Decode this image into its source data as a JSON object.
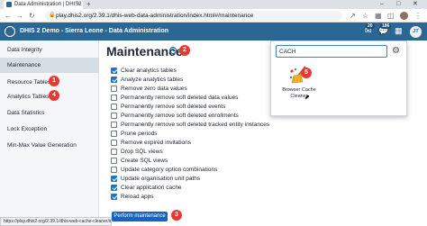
{
  "browser": {
    "tab_title": "Data Administration | DHIS2",
    "tab_close": "×",
    "new_tab": "+",
    "url": "play.dhis2.org/2.39.1/dhis-web-data-administration/index.html#/maintenance",
    "status_url": "https://play.dhis2.org/2.39.1/dhis-web-cache-cleaner/index.action"
  },
  "header": {
    "title": "DHIS 2 Demo - Sierra Leone - Data Administration",
    "messages_count": "20",
    "interpretations_count": "186",
    "user_initials": "JT"
  },
  "sidebar": {
    "items": [
      {
        "label": "Data Integrity"
      },
      {
        "label": "Maintenance"
      },
      {
        "label": "Resource Tables"
      },
      {
        "label": "Analytics Tables"
      },
      {
        "label": "Data Statistics"
      },
      {
        "label": "Lock Exception"
      },
      {
        "label": "Min-Max Value Generation"
      }
    ]
  },
  "main": {
    "title": "Maintenance",
    "help": "?",
    "options": [
      {
        "label": "Clear analytics tables",
        "checked": true
      },
      {
        "label": "Analyze analytics tables",
        "checked": true
      },
      {
        "label": "Remove zero data values",
        "checked": false
      },
      {
        "label": "Permanently remove soft deleted data values",
        "checked": false
      },
      {
        "label": "Permanently remove soft deleted events",
        "checked": false
      },
      {
        "label": "Permanently remove soft deleted enrollments",
        "checked": false
      },
      {
        "label": "Permanently remove soft deleted tracked entity instances",
        "checked": false
      },
      {
        "label": "Prune periods",
        "checked": false
      },
      {
        "label": "Remove expired invitations",
        "checked": false
      },
      {
        "label": "Drop SQL views",
        "checked": false
      },
      {
        "label": "Create SQL views",
        "checked": false
      },
      {
        "label": "Update category option combinations",
        "checked": false
      },
      {
        "label": "Update organisation unit paths",
        "checked": true
      },
      {
        "label": "Clear application cache",
        "checked": true
      },
      {
        "label": "Reload apps",
        "checked": true
      }
    ],
    "perform_button": "Perform maintenance"
  },
  "app_search": {
    "query": "CACH",
    "results": [
      {
        "name": "Browser Cache Cleaner",
        "icon": "broom-icon"
      }
    ]
  },
  "markers": [
    "1",
    "2",
    "3",
    "4",
    "5"
  ],
  "colors": {
    "header_bg": "#2c6693",
    "primary_button": "#1565c0",
    "checkbox_checked": "#1976d2",
    "marker": "#e53935"
  }
}
